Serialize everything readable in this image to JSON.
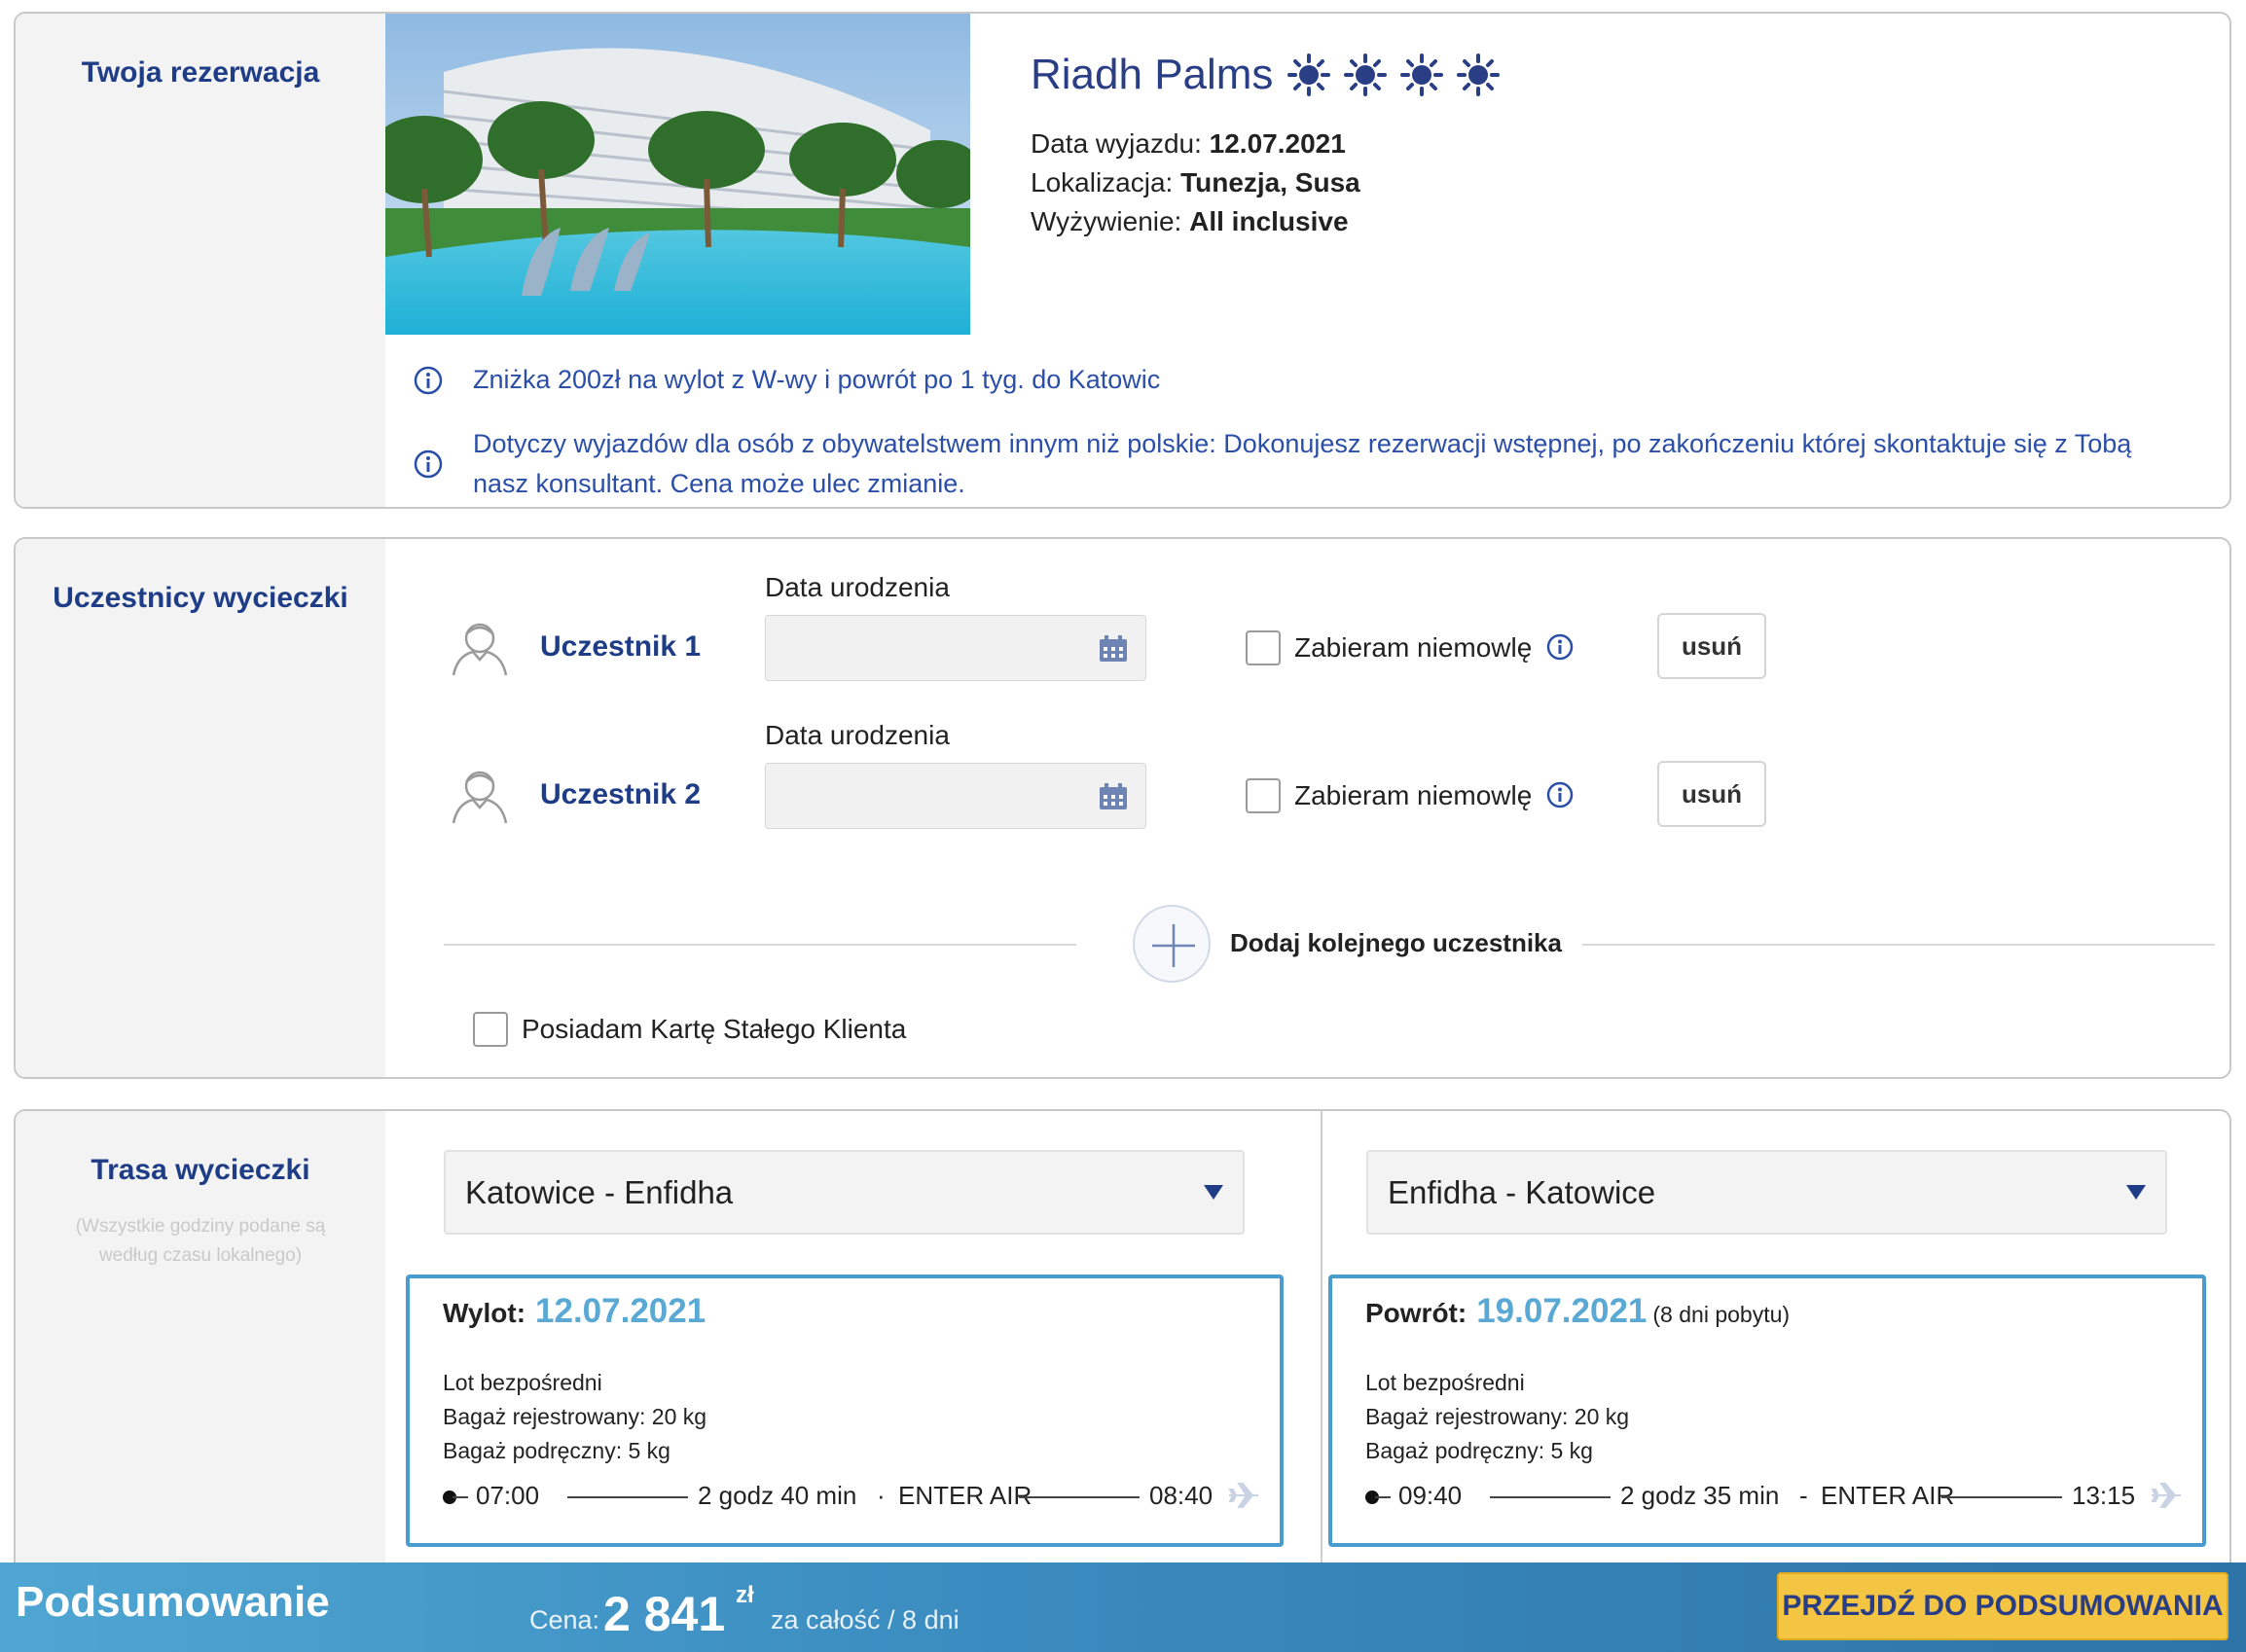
{
  "reservation": {
    "section_title": "Twoja rezerwacja",
    "hotel_name": "Riadh Palms",
    "rating": 4,
    "rating_icon": "sun-icon",
    "details": [
      {
        "label": "Data wyjazdu:",
        "value": "12.07.2021"
      },
      {
        "label": "Lokalizacja:",
        "value": "Tunezja, Susa"
      },
      {
        "label": "Wyżywienie:",
        "value": "All inclusive"
      }
    ],
    "notices": [
      "Zniżka 200zł na wylot z W-wy i powrót po 1 tyg. do Katowic",
      "Dotyczy wyjazdów dla osób z obywatelstwem innym niż polskie: Dokonujesz rezerwacji wstępnej, po zakończeniu której skontaktuje się z Tobą nasz konsultant. Cena może ulec zmianie."
    ]
  },
  "participants": {
    "section_title": "Uczestnicy wycieczki",
    "date_label": "Data urodzenia",
    "infant_label": "Zabieram niemowlę",
    "remove_label": "usuń",
    "items": [
      {
        "name": "Uczestnik 1",
        "birth_date": ""
      },
      {
        "name": "Uczestnik 2",
        "birth_date": ""
      }
    ],
    "add_label": "Dodaj kolejnego uczestnika",
    "loyalty_label": "Posiadam Kartę Stałego Klienta"
  },
  "route": {
    "section_title": "Trasa wycieczki",
    "note": "(Wszystkie godziny podane są według czasu lokalnego)",
    "outbound": {
      "select": "Katowice - Enfidha",
      "label": "Wylot:",
      "date": "12.07.2021",
      "stay": "",
      "type": "Lot bezpośredni",
      "checked_bag": "Bagaż rejestrowany: 20 kg",
      "hand_bag": "Bagaż podręczny: 5 kg",
      "depart": "07:00",
      "duration": "2 godz 40 min",
      "sep": "·",
      "airline": "ENTER AIR",
      "arrive": "08:40"
    },
    "return": {
      "select": "Enfidha - Katowice",
      "label": "Powrót:",
      "date": "19.07.2021",
      "stay": "(8 dni pobytu)",
      "type": "Lot bezpośredni",
      "checked_bag": "Bagaż rejestrowany: 20 kg",
      "hand_bag": "Bagaż podręczny: 5 kg",
      "depart": "09:40",
      "duration": "2 godz 35 min",
      "sep": "-",
      "airline": "ENTER AIR",
      "arrive": "13:15"
    }
  },
  "summary": {
    "title": "Podsumowanie",
    "price_label": "Cena:",
    "price": "2 841",
    "currency": "zł",
    "price_suffix": "za całość / 8 dni",
    "cta": "PRZEJDŹ DO PODSUMOWANIA"
  },
  "colors": {
    "brand_navy": "#1f3d87",
    "link_blue": "#2b4fa8",
    "flight_border": "#4a9cd0",
    "cta_yellow": "#f4c542"
  }
}
